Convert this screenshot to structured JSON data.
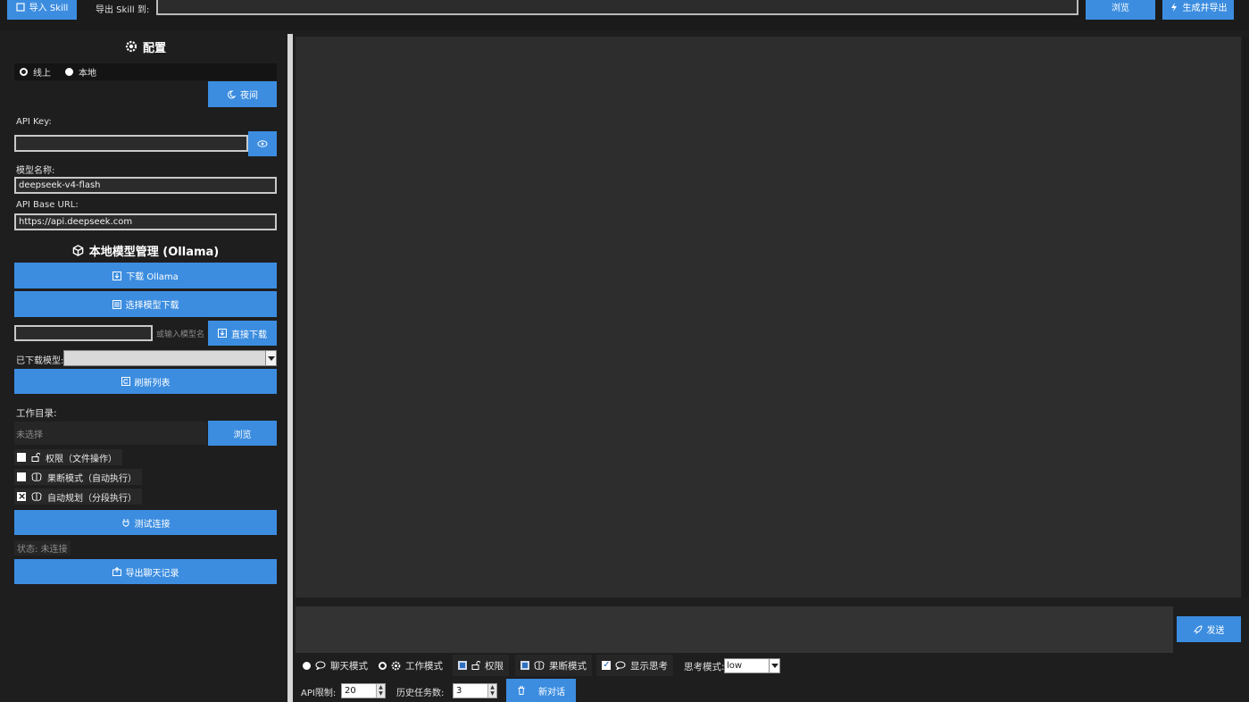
{
  "toolbar": {
    "import_skill": "导入 Skill",
    "export_skill_to": "导出 Skill 到:",
    "browse": "浏览",
    "generate_export": "生成并导出"
  },
  "config": {
    "title": "配置",
    "mode_online": "线上",
    "mode_local": "本地",
    "mode_selected": "本地",
    "night_button": "夜间",
    "api_key_label": "API Key:",
    "api_key_value": "",
    "model_name_label": "模型名称:",
    "model_name_value": "deepseek-v4-flash",
    "api_base_label": "API Base URL:",
    "api_base_value": "https://api.deepseek.com"
  },
  "ollama": {
    "title": "本地模型管理 (Ollama)",
    "download_ollama": "下载 Ollama",
    "choose_model_download": "选择模型下载",
    "model_name_input": "",
    "model_name_hint": "或输入模型名",
    "direct_download": "直接下载",
    "downloaded_models_label": "已下载模型:",
    "downloaded_models_value": "",
    "refresh_list": "刷新列表"
  },
  "workdir": {
    "label": "工作目录:",
    "value": "未选择",
    "browse": "浏览"
  },
  "options": [
    {
      "label": "权限（文件操作）",
      "checked": false,
      "icon": "unlock-icon"
    },
    {
      "label": "果断模式（自动执行）",
      "checked": false,
      "icon": "brain-icon"
    },
    {
      "label": "自动规划（分段执行）",
      "checked": true,
      "icon": "brain-icon"
    }
  ],
  "connection": {
    "test_button": "测试连接",
    "status": "状态: 未连接",
    "export_chat": "导出聊天记录"
  },
  "chat": {
    "send": "发送",
    "input_value": ""
  },
  "bottom_bar": {
    "chat_mode": "聊天模式",
    "work_mode": "工作模式",
    "mode_selected": "聊天模式",
    "permission": "权限",
    "decisive_mode": "果断模式",
    "show_thinking": "显示思考",
    "thinking_mode_label": "思考模式:",
    "thinking_mode_value": "low",
    "api_limit_label": "API限制:",
    "api_limit_value": "20",
    "history_tasks_label": "历史任务数:",
    "history_tasks_value": "3",
    "new_chat": "新对话"
  },
  "colors": {
    "accent": "#3c8de0",
    "background": "#1e1e1e",
    "chat_bg": "#2d2d2d"
  }
}
